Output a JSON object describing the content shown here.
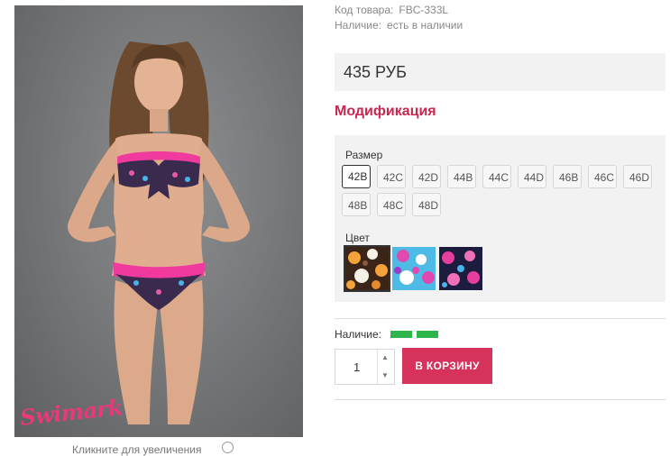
{
  "photo": {
    "alt_icon": "product-photo",
    "brand_logo": "Swimark",
    "caption": "Кликните для увеличения"
  },
  "product": {
    "code_label": "Код товара:",
    "code_value": "FBC-333L",
    "availability_label": "Наличие:",
    "availability_value": "есть в наличии",
    "price": "435 РУБ"
  },
  "modification": {
    "title": "Модификация",
    "size_label": "Размер",
    "sizes": [
      "42B",
      "42C",
      "42D",
      "44B",
      "44C",
      "44D",
      "46B",
      "46C",
      "46D",
      "48B",
      "48C",
      "48D"
    ],
    "selected_size": "42B",
    "color_label": "Цвет",
    "colors": [
      {
        "name": "brown-orange-pattern",
        "selected": true
      },
      {
        "name": "blue-pink-pattern",
        "selected": false
      },
      {
        "name": "navy-pink-pattern",
        "selected": false
      }
    ]
  },
  "stock": {
    "label": "Наличие:",
    "level_bars": 2,
    "bar_color": "#2eb54a"
  },
  "cart": {
    "quantity": "1",
    "button_label": "В КОРЗИНУ",
    "button_color": "#d6325b"
  }
}
